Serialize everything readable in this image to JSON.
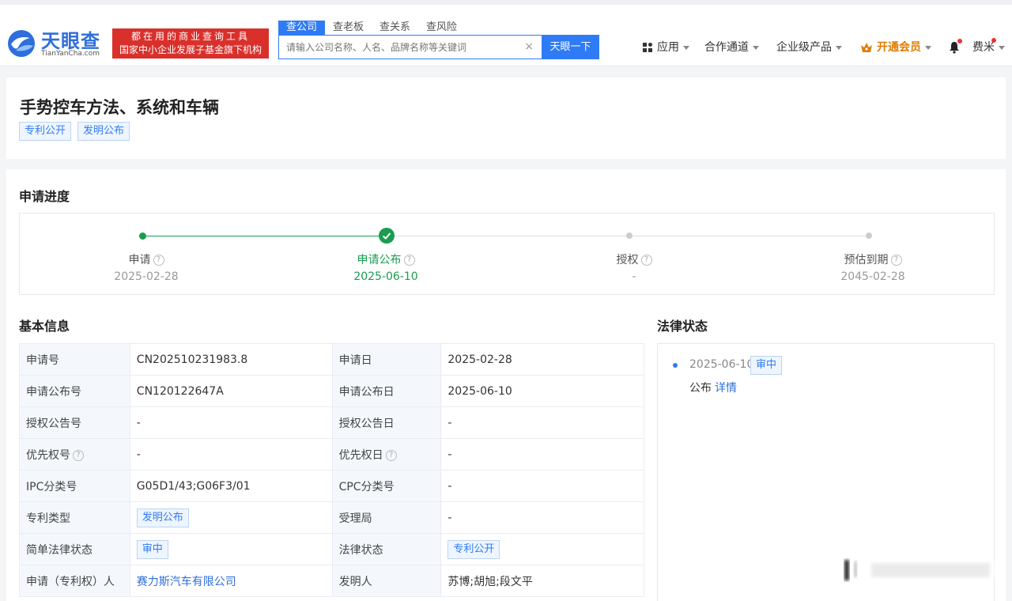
{
  "header": {
    "logo_text": "天眼查",
    "logo_sub": "TianYanCha.com",
    "slogan_line1": "都在用的商业查询工具",
    "slogan_line2": "国家中小企业发展子基金旗下机构",
    "search_tabs": [
      "查公司",
      "查老板",
      "查关系",
      "查风险"
    ],
    "search_placeholder": "请输入公司名称、人名、品牌名称等关键词",
    "search_clear": "×",
    "search_button": "天眼一下",
    "nav": {
      "apps": "应用",
      "channel": "合作通道",
      "enterprise": "企业级产品",
      "vip": "开通会员",
      "user": "费米"
    }
  },
  "title": {
    "text": "手势控车方法、系统和车辆",
    "tags": [
      "专利公开",
      "发明公布"
    ]
  },
  "progress": {
    "section_title": "申请进度",
    "steps": [
      {
        "name": "申请",
        "date": "2025-02-28"
      },
      {
        "name": "申请公布",
        "date": "2025-06-10"
      },
      {
        "name": "授权",
        "date": "-"
      },
      {
        "name": "预估到期",
        "date": "2045-02-28"
      }
    ],
    "help_glyph": "?"
  },
  "basic_info": {
    "section_title": "基本信息",
    "rows": [
      {
        "k1": "申请号",
        "v1": "CN202510231983.8",
        "k2": "申请日",
        "v2": "2025-02-28"
      },
      {
        "k1": "申请公布号",
        "v1": "CN120122647A",
        "k2": "申请公布日",
        "v2": "2025-06-10"
      },
      {
        "k1": "授权公告号",
        "v1": "-",
        "k2": "授权公告日",
        "v2": "-"
      },
      {
        "k1": "优先权号",
        "v1": "-",
        "k2": "优先权日",
        "v2": "-"
      },
      {
        "k1": "IPC分类号",
        "v1": "G05D1/43;G06F3/01",
        "k2": "CPC分类号",
        "v2": "-"
      },
      {
        "k1": "专利类型",
        "v1": "发明公布",
        "k2": "受理局",
        "v2": "-"
      },
      {
        "k1": "简单法律状态",
        "v1": "审中",
        "k2": "法律状态",
        "v2": "专利公开"
      },
      {
        "k1": "申请（专利权）人",
        "v1": "赛力斯汽车有限公司",
        "k2": "发明人",
        "v2": "苏博;胡旭;段文平"
      }
    ]
  },
  "legal_status": {
    "section_title": "法律状态",
    "date": "2025-06-10",
    "tag": "审中",
    "desc": "公布",
    "detail_link": "详情"
  },
  "colors": {
    "brand_blue": "#2f7bf5",
    "slogan_red": "#d9302c",
    "progress_green": "#1a9c50",
    "vip_orange": "#e07b00"
  }
}
